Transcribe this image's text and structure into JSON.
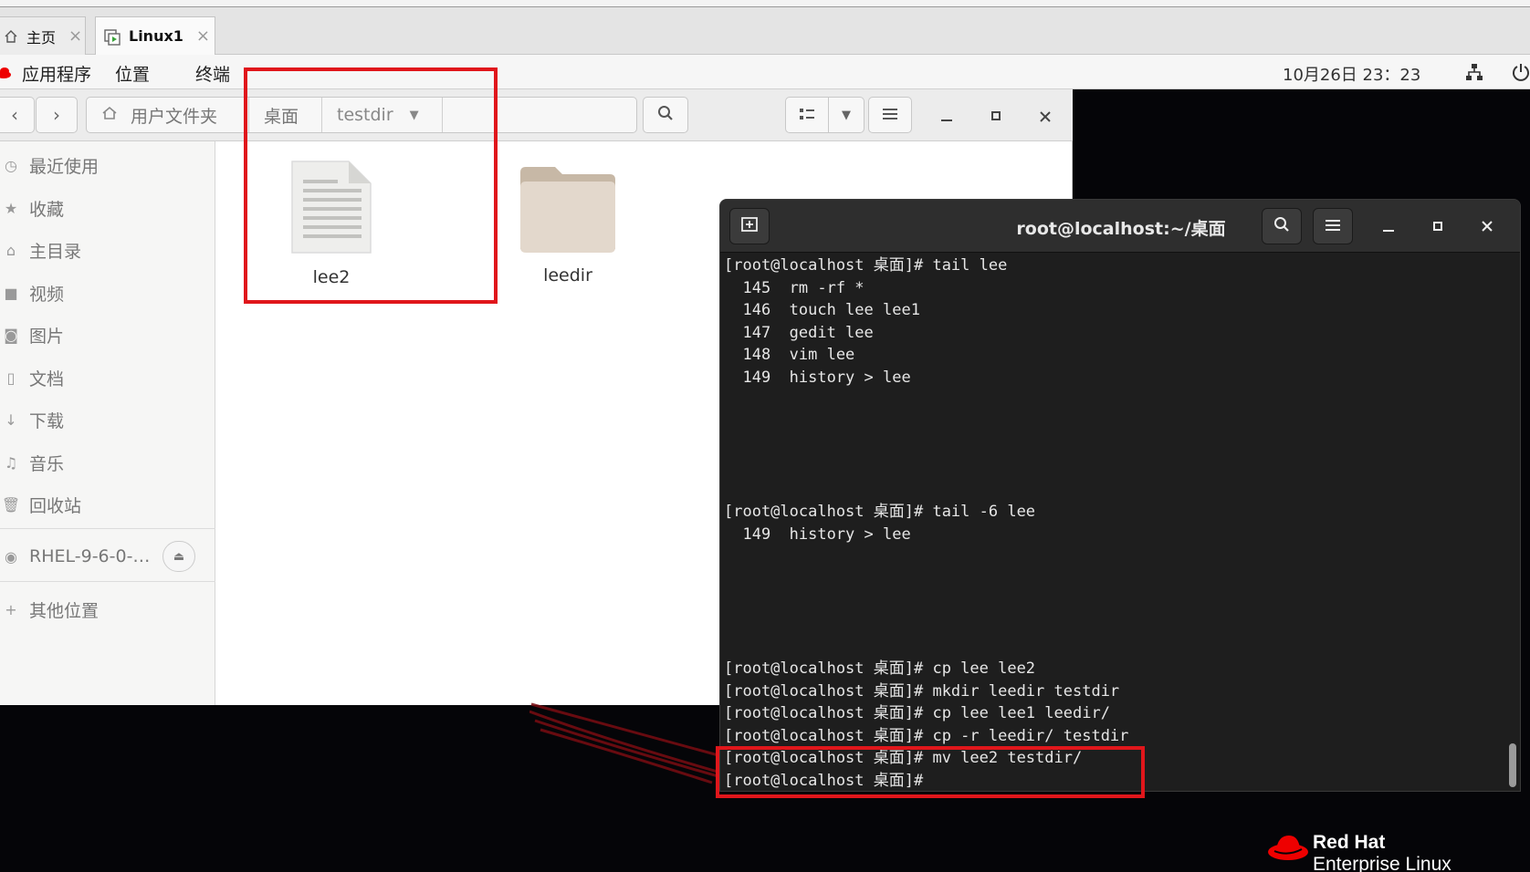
{
  "vm_tabs": [
    {
      "label": "主页",
      "close": "×"
    },
    {
      "label": "Linux1",
      "close": "×"
    }
  ],
  "topbar": {
    "menus": [
      "应用程序",
      "位置",
      "终端"
    ],
    "clock": "10月26日 23：23"
  },
  "files": {
    "path": [
      "用户文件夹",
      "桌面",
      "testdir"
    ],
    "sidebar": [
      {
        "icon": "clock-icon",
        "label": "最近使用"
      },
      {
        "icon": "star-icon",
        "label": "收藏"
      },
      {
        "icon": "home-icon",
        "label": "主目录"
      },
      {
        "icon": "video-icon",
        "label": "视频"
      },
      {
        "icon": "camera-icon",
        "label": "图片"
      },
      {
        "icon": "document-icon",
        "label": "文档"
      },
      {
        "icon": "download-icon",
        "label": "下载"
      },
      {
        "icon": "music-icon",
        "label": "音乐"
      },
      {
        "icon": "trash-icon",
        "label": "回收站"
      }
    ],
    "device": {
      "label": "RHEL-9-6-0-…"
    },
    "other_locations": {
      "label": "其他位置"
    },
    "items": [
      {
        "name": "lee2",
        "type": "text-file"
      },
      {
        "name": "leedir",
        "type": "folder"
      }
    ]
  },
  "terminal": {
    "title": "root@localhost:~/桌面",
    "lines": [
      {
        "row": 0,
        "text": "[root@localhost 桌面]# tail lee"
      },
      {
        "row": 1,
        "text": "  145  rm -rf *"
      },
      {
        "row": 2,
        "text": "  146  touch lee lee1"
      },
      {
        "row": 3,
        "text": "  147  gedit lee"
      },
      {
        "row": 4,
        "text": "  148  vim lee"
      },
      {
        "row": 5,
        "text": "  149  history > lee"
      },
      {
        "row": 11,
        "text": "[root@localhost 桌面]# tail -6 lee"
      },
      {
        "row": 12,
        "text": "  149  history > lee"
      },
      {
        "row": 18,
        "text": "[root@localhost 桌面]# cp lee lee2"
      },
      {
        "row": 19,
        "text": "[root@localhost 桌面]# mkdir leedir testdir"
      },
      {
        "row": 20,
        "text": "[root@localhost 桌面]# cp lee lee1 leedir/"
      },
      {
        "row": 21,
        "text": "[root@localhost 桌面]# cp -r leedir/ testdir"
      },
      {
        "row": 22,
        "text": "[root@localhost 桌面]# mv lee2 testdir/"
      },
      {
        "row": 23,
        "text": "[root@localhost 桌面]#"
      }
    ]
  },
  "branding": {
    "line1": "Red Hat",
    "line2": "Enterprise Linux"
  },
  "colors": {
    "annotation": "#e0161b",
    "terminal_bg": "#1e1e1e",
    "redhat_red": "#ee0000"
  }
}
